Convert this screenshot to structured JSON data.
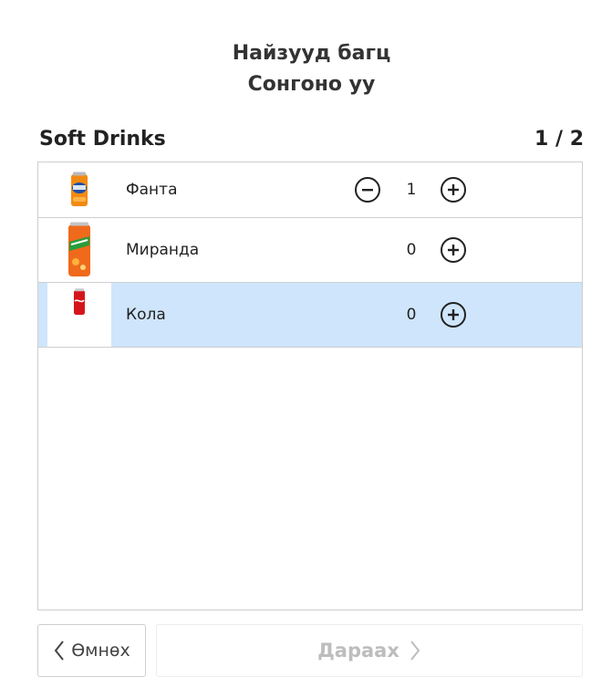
{
  "header": {
    "title_line1": "Найзууд багц",
    "title_line2": "Сонгоно уу"
  },
  "section": {
    "name": "Soft Drinks",
    "page_indicator": "1 / 2"
  },
  "items": [
    {
      "name": "Фанта",
      "quantity": "1",
      "icon": "fanta-can-icon",
      "has_minus": true,
      "selected": false
    },
    {
      "name": "Миранда",
      "quantity": "0",
      "icon": "mirinda-can-icon",
      "has_minus": false,
      "selected": false
    },
    {
      "name": "Кола",
      "quantity": "0",
      "icon": "cola-can-icon",
      "has_minus": false,
      "selected": true
    }
  ],
  "footer": {
    "back_label": "Өмнөх",
    "next_label": "Дараах",
    "next_enabled": false
  },
  "colors": {
    "selected_row": "#cfe5fb",
    "border": "#cfcfcf",
    "disabled_text": "#bdbdbd"
  }
}
